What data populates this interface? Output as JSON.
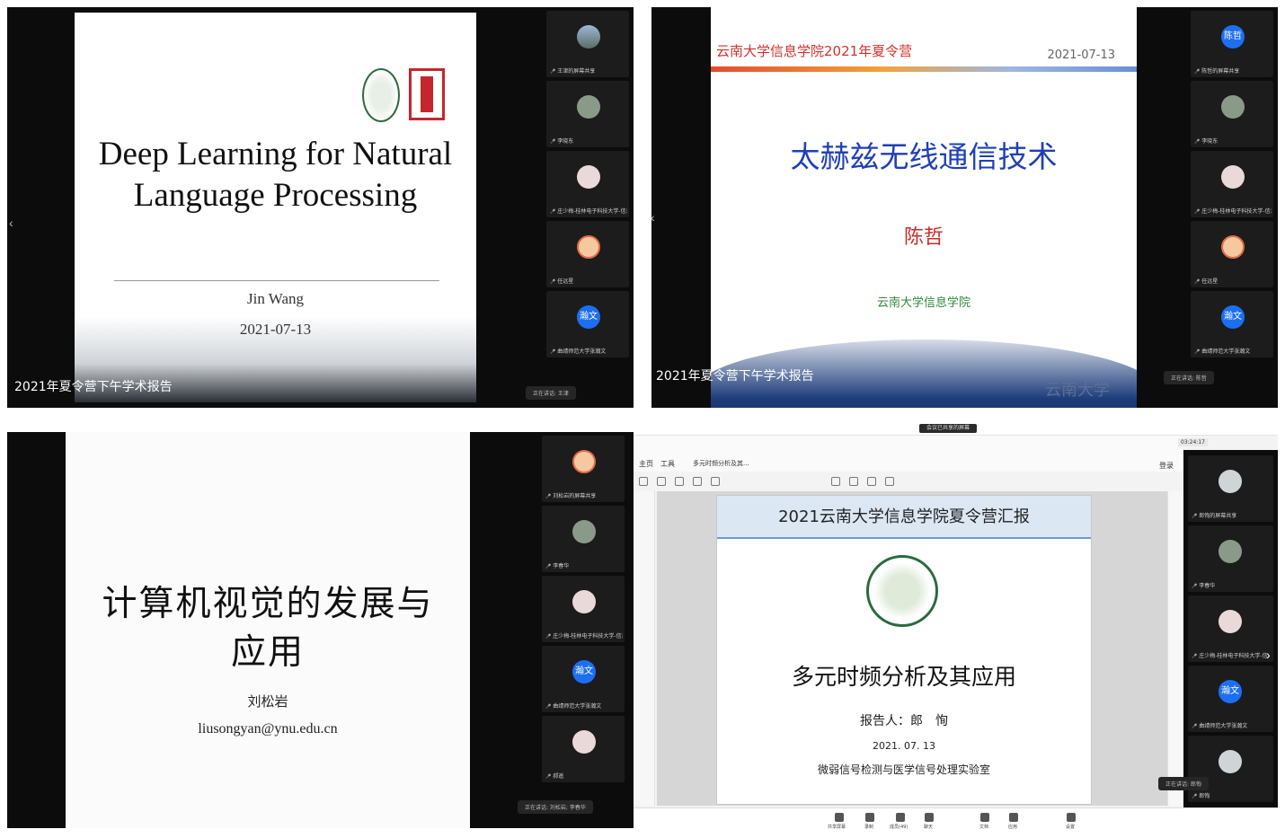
{
  "panel1": {
    "slide_title": "Deep Learning for Natural Language Processing",
    "author": "Jin Wang",
    "date": "2021-07-13",
    "caption": "2021年夏令营下午学术报告",
    "speaking": "正在讲话: 王津",
    "participants": [
      "王津的屏幕共享",
      "李晓东",
      "庄少梅-桂林电子科技大学-信息与计...",
      "任远星",
      "曲靖师范大学张瀚文"
    ]
  },
  "panel2": {
    "header": "云南大学信息学院2021年夏令营",
    "date": "2021-07-13",
    "slide_title": "太赫兹无线通信技术",
    "presenter": "陈哲",
    "org": "云南大学信息学院",
    "stamp": "云南大学",
    "caption": "2021年夏令营下午学术报告",
    "speaking": "正在讲话: 陈哲",
    "participants": [
      "陈哲的屏幕共享",
      "李晓东",
      "庄少梅-桂林电子科技大学-信息与计...",
      "任远星",
      "曲靖师范大学张瀚文"
    ],
    "avatar_label": "陈哲"
  },
  "panel3": {
    "slide_title_line1": "计算机视觉的发展与",
    "slide_title_line2": "应用",
    "author": "刘松岩",
    "email": "liusongyan@ynu.edu.cn",
    "speaking": "正在讲话: 刘松岩; 李春华",
    "participants": [
      "刘松岩的屏幕共享",
      "李春华",
      "庄少梅-桂林电子科技大学-信息与计...",
      "曲靖师范大学张瀚文",
      "郝遥"
    ]
  },
  "panel4": {
    "window_title": "会议已共享的屏幕",
    "menu_home": "主页",
    "menu_tools": "工具",
    "doc_tab": "多元时频分析及其...",
    "login": "登录",
    "time": "03:24:17",
    "doc_header": "2021云南大学信息学院夏令营汇报",
    "doc_title": "多元时频分析及其应用",
    "reporter": "报告人：郎　恂",
    "doc_date": "2021. 07. 13",
    "lab": "微弱信号检测与医学信号处理实验室",
    "speaking": "正在讲话: 郎恂",
    "participants": [
      "郎恂的屏幕共享",
      "李春华",
      "庄少梅-桂林电子科技大学-信息与计...",
      "曲靖师范大学张瀚文",
      "郎恂"
    ],
    "bottom_labels": [
      "共享屏幕",
      "录制",
      "成员(49)",
      "聊天",
      "文档",
      "应用",
      "设置"
    ]
  },
  "avatar_label": "瀚文",
  "colors": {
    "panel_bg": "#0c0c0c",
    "accent_blue": "#1d6ff2",
    "slide2_title": "#1f3fb5",
    "slide2_red": "#cc2b2b"
  }
}
